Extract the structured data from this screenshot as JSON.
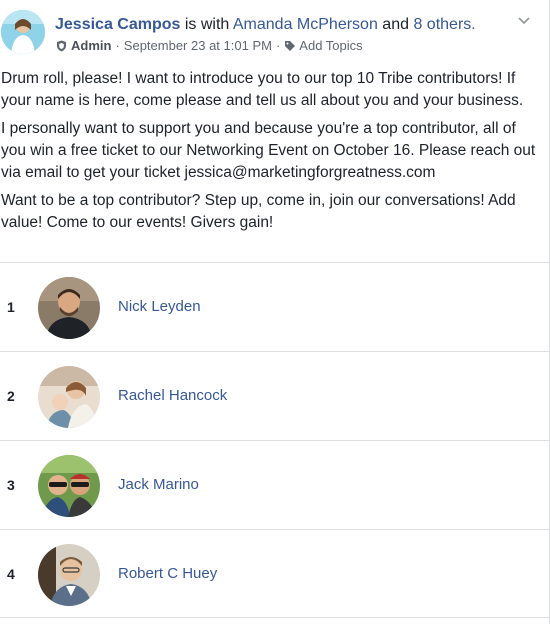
{
  "post": {
    "author": "Jessica Campos",
    "with_text": "is with",
    "tagged": "Amanda McPherson",
    "and_text": "and",
    "others": "8 others.",
    "role": "Admin",
    "date": "September 23 at 1:01 PM",
    "separator": "·",
    "add_topics": "Add Topics",
    "paragraphs": [
      "Drum roll, please! I want to introduce you to our top 10 Tribe contributors! If your name is here, come please and tell us all about you and your business.",
      "I personally want to support you and because you're a top contributor, all of you win a free ticket to our Networking Event on October 16. Please reach out via email to get your ticket jessica@marketingforgreatness.com",
      "Want to be a top contributor? Step up, come in, join our conversations! Add value! Come to our events! Givers gain!"
    ]
  },
  "contributors": [
    {
      "rank": "1",
      "name": "Nick Leyden"
    },
    {
      "rank": "2",
      "name": "Rachel Hancock"
    },
    {
      "rank": "3",
      "name": "Jack Marino"
    },
    {
      "rank": "4",
      "name": "Robert C Huey"
    }
  ],
  "icons": {
    "role": "shield-icon",
    "topics": "tag-icon",
    "menu": "chevron-down-icon"
  },
  "colors": {
    "link": "#365899",
    "text": "#1d2129",
    "meta": "#616770",
    "divider": "#dddfe2"
  }
}
